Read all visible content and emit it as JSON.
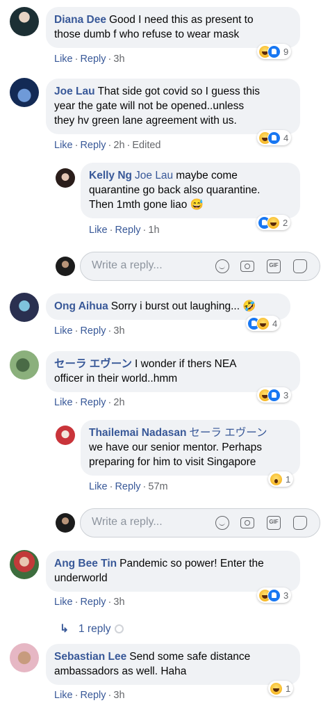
{
  "comments": [
    {
      "author": "Diana Dee",
      "text_lines": [
        "Good I need this as present to",
        "those dumb f who refuse to wear mask"
      ],
      "like": "Like",
      "reply": "Reply",
      "time": "3h",
      "reaction_count": "9"
    },
    {
      "author": "Joe Lau",
      "text_lines": [
        "That side got covid so I guess this",
        "year the gate will not be opened..unless",
        "they hv green lane agreement with us."
      ],
      "like": "Like",
      "reply": "Reply",
      "time": "2h",
      "edited": "Edited",
      "reaction_count": "4",
      "replies": [
        {
          "author": "Kelly Ng",
          "tag": "Joe Lau",
          "text_lines": [
            "maybe come",
            "quarantine go back also quarantine.",
            "Then 1mth gone liao"
          ],
          "emoji": "😅",
          "like": "Like",
          "reply": "Reply",
          "time": "1h",
          "reaction_count": "2"
        }
      ],
      "reply_placeholder": "Write a reply..."
    },
    {
      "author": "Ong Aihua",
      "text_lines": [
        "Sorry i burst out laughing..."
      ],
      "emoji": "🤣",
      "like": "Like",
      "reply": "Reply",
      "time": "3h",
      "reaction_count": "4"
    },
    {
      "author": "セーラ エヴーン",
      "text_lines": [
        "I wonder if thers NEA",
        "officer in their world..hmm"
      ],
      "like": "Like",
      "reply": "Reply",
      "time": "2h",
      "reaction_count": "3",
      "replies": [
        {
          "author": "Thailemai Nadasan",
          "tag": "セーラ エヴーン",
          "text_lines": [
            "we have our senior mentor. Perhaps",
            "preparing for him to visit Singapore"
          ],
          "like": "Like",
          "reply": "Reply",
          "time": "57m",
          "reaction_count": "1"
        }
      ],
      "reply_placeholder": "Write a reply..."
    },
    {
      "author": "Ang Bee Tin",
      "text_lines": [
        "Pandemic so power! Enter the",
        "underworld"
      ],
      "like": "Like",
      "reply": "Reply",
      "time": "3h",
      "reaction_count": "3",
      "view_replies": "1 reply"
    },
    {
      "author": "Sebastian Lee",
      "text_lines": [
        "Send some safe distance",
        "ambassadors as well. Haha"
      ],
      "like": "Like",
      "reply": "Reply",
      "time": "3h",
      "reaction_count": "1"
    }
  ],
  "colors": {
    "link": "#385898",
    "bubble": "#f0f2f5",
    "meta": "#65676b",
    "like_blue": "#1877f2",
    "haha_yellow": "#f7b928"
  },
  "icons": [
    "emoji-icon",
    "camera-icon",
    "gif-icon",
    "sticker-icon",
    "reply-arrow-icon"
  ]
}
